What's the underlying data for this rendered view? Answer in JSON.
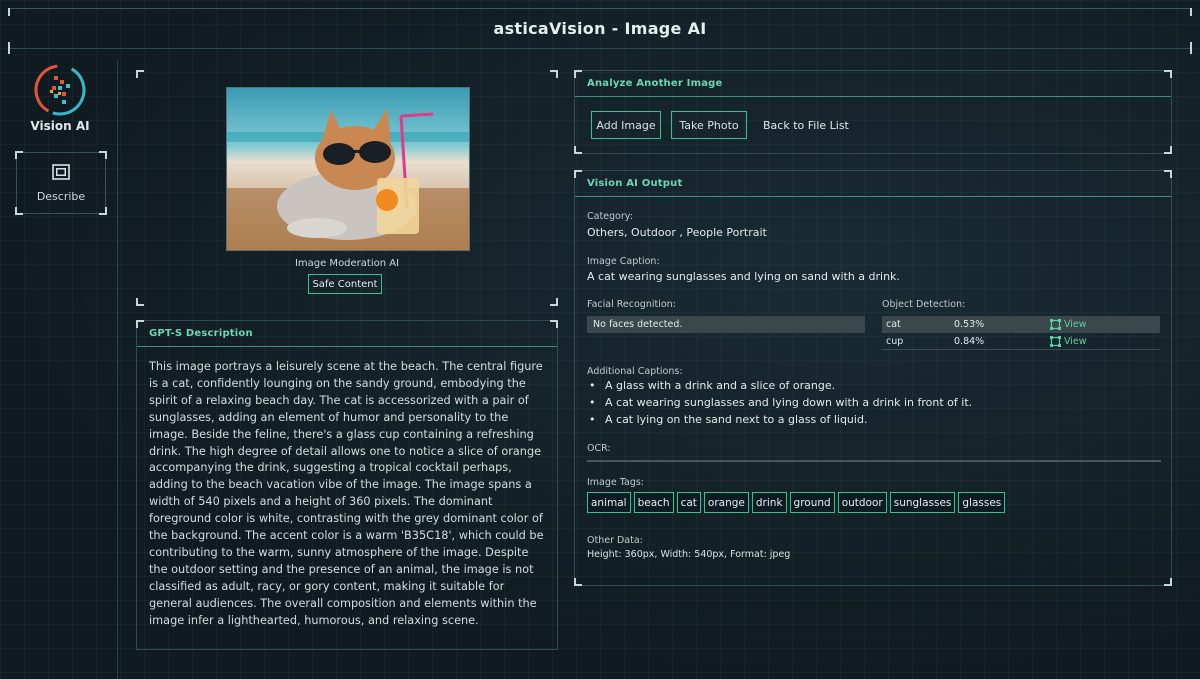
{
  "app": {
    "title": "asticaVision - Image AI"
  },
  "sidebar": {
    "logo_label": "Vision AI",
    "nav": [
      {
        "label": "Describe",
        "icon": "image-icon"
      }
    ]
  },
  "image_panel": {
    "caption": "Image Moderation AI",
    "moderation_result": "Safe Content"
  },
  "description": {
    "header": "GPT-S Description",
    "text": "This image portrays a leisurely scene at the beach. The central figure is a cat, confidently lounging on the sandy ground, embodying the spirit of a relaxing beach day. The cat is accessorized with a pair of sunglasses, adding an element of humor and personality to the image. Beside the feline, there's a glass cup containing a refreshing drink. The high degree of detail allows one to notice a slice of orange accompanying the drink, suggesting a tropical cocktail perhaps, adding to the beach vacation vibe of the image. The image spans a width of 540 pixels and a height of 360 pixels. The dominant foreground color is white, contrasting with the grey dominant color of the background. The accent color is a warm 'B35C18', which could be contributing to the warm, sunny atmosphere of the image. Despite the outdoor setting and the presence of an animal, the image is not classified as adult, racy, or gory content, making it suitable for general audiences. The overall composition and elements within the image infer a lighthearted, humorous, and relaxing scene."
  },
  "analyze": {
    "header": "Analyze Another Image",
    "add_image": "Add Image",
    "take_photo": "Take Photo",
    "back": "Back to File List"
  },
  "output": {
    "header": "Vision AI Output",
    "category_label": "Category:",
    "category_value": "Others, Outdoor , People Portrait",
    "caption_label": "Image Caption:",
    "caption_value": "A cat wearing sunglasses and lying on sand with a drink.",
    "faces_label": "Facial Recognition:",
    "faces_value": "No faces detected.",
    "objects_label": "Object Detection:",
    "objects": [
      {
        "name": "cat",
        "confidence": "0.53%",
        "action": "View"
      },
      {
        "name": "cup",
        "confidence": "0.84%",
        "action": "View"
      }
    ],
    "additional_label": "Additional Captions:",
    "additional": [
      "A glass with a drink and a slice of orange.",
      "A cat wearing sunglasses and lying down with a drink in front of it.",
      "A cat lying on the sand next to a glass of liquid."
    ],
    "ocr_label": "OCR:",
    "tags_label": "Image Tags:",
    "tags": [
      "animal",
      "beach",
      "cat",
      "orange",
      "drink",
      "ground",
      "outdoor",
      "sunglasses",
      "glasses"
    ],
    "other_label": "Other Data:",
    "other_value": "Height: 360px, Width: 540px, Format: jpeg"
  },
  "colors": {
    "accent": "#6ed6b4",
    "border": "#3fbf8f",
    "background": "#0f1b22"
  }
}
